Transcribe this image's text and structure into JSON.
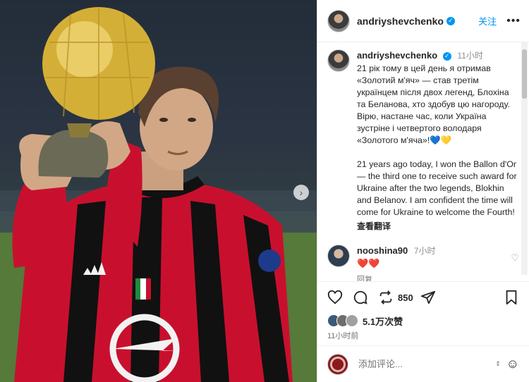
{
  "post": {
    "author": "andriyshevchenko",
    "follow_label": "关注",
    "more_label": "•••",
    "next_label": "›"
  },
  "caption": {
    "author": "andriyshevchenko",
    "time": "11小时",
    "text": "21 рік тому в цей день я отримав «Золотий м'яч» — став третім українцем після двох легенд, Блохіна та Беланова, хто здобув цю нагороду. Вірю, настане час, коли Україна зустріне і четвертого володаря «Золотого м'яча»!💙💛\n\n21 years ago today, I won the Ballon d'Or — the third one to receive such award for Ukraine after the two legends, Blokhin and Belanov. I am confident the time will come for Ukraine to welcome the Fourth!",
    "see_translation": "查看翻译"
  },
  "reply": {
    "author": "nooshina90",
    "time": "7小时",
    "text": "❤️❤️",
    "reply_label": "回复"
  },
  "actions": {
    "share_count": "850"
  },
  "likes": {
    "text": "5.1万次赞",
    "avatar_colors": [
      "#3b5a7a",
      "#6d6d6d",
      "#a0a0a0"
    ]
  },
  "post_time": "11小时前",
  "comment_box": {
    "placeholder": "添加评论...",
    "emoji": "☺"
  },
  "colors": {
    "accent": "#0095f6",
    "jersey_red": "#c8102e",
    "trophy_gold": "#d4af37"
  },
  "icons": [
    "heart-icon",
    "comment-icon",
    "repost-icon",
    "share-icon",
    "bookmark-icon",
    "verified-icon",
    "emoji-icon"
  ]
}
